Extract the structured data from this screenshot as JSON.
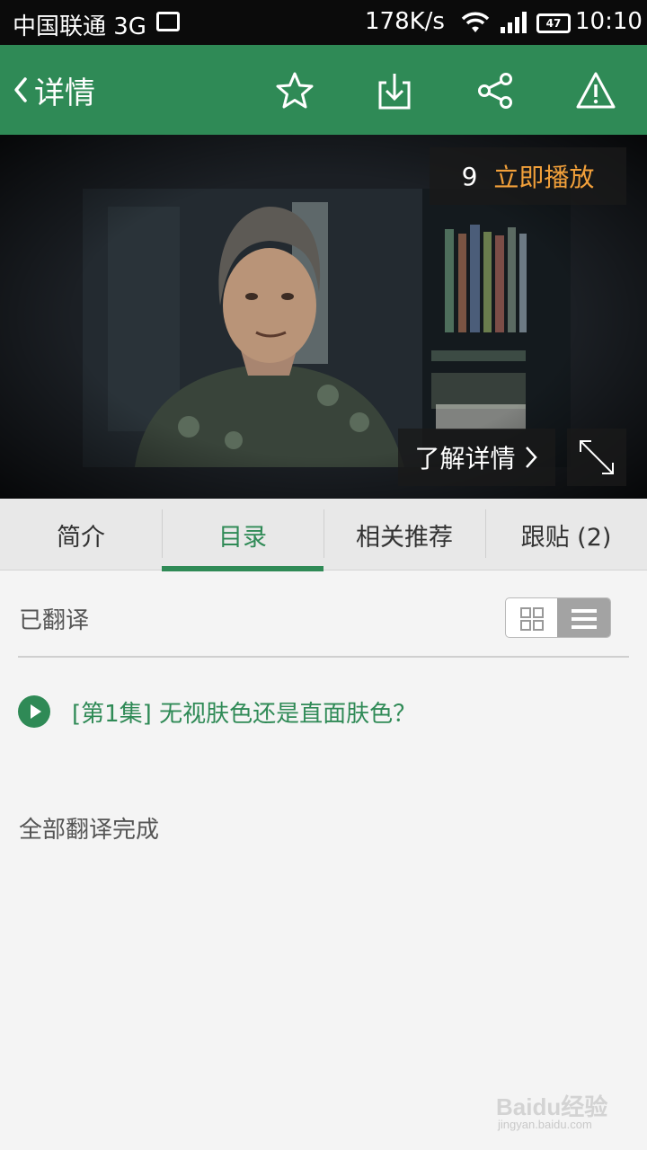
{
  "status_bar": {
    "carrier": "中国联通 3G",
    "net_speed": "178K/s",
    "battery": "47",
    "time": "10:10"
  },
  "header": {
    "back_label": "详情",
    "icons": [
      "star-icon",
      "download-icon",
      "share-icon",
      "warning-icon"
    ],
    "color": "#2f8a56"
  },
  "video": {
    "episode_count": "9",
    "play_now": "立即播放",
    "learn_more": "了解详情",
    "accent": "#f2a03a"
  },
  "tabs": [
    {
      "label": "简介",
      "active": false
    },
    {
      "label": "目录",
      "active": true
    },
    {
      "label": "相关推荐",
      "active": false
    },
    {
      "label": "跟贴 (2)",
      "active": false
    }
  ],
  "catalog": {
    "section_label": "已翻译",
    "view_mode": "list",
    "episodes": [
      {
        "title": "[第1集] 无视肤色还是直面肤色？"
      }
    ],
    "footer_note": "全部翻译完成"
  },
  "watermark": {
    "brand": "Baidu经验",
    "url": "jingyan.baidu.com"
  }
}
